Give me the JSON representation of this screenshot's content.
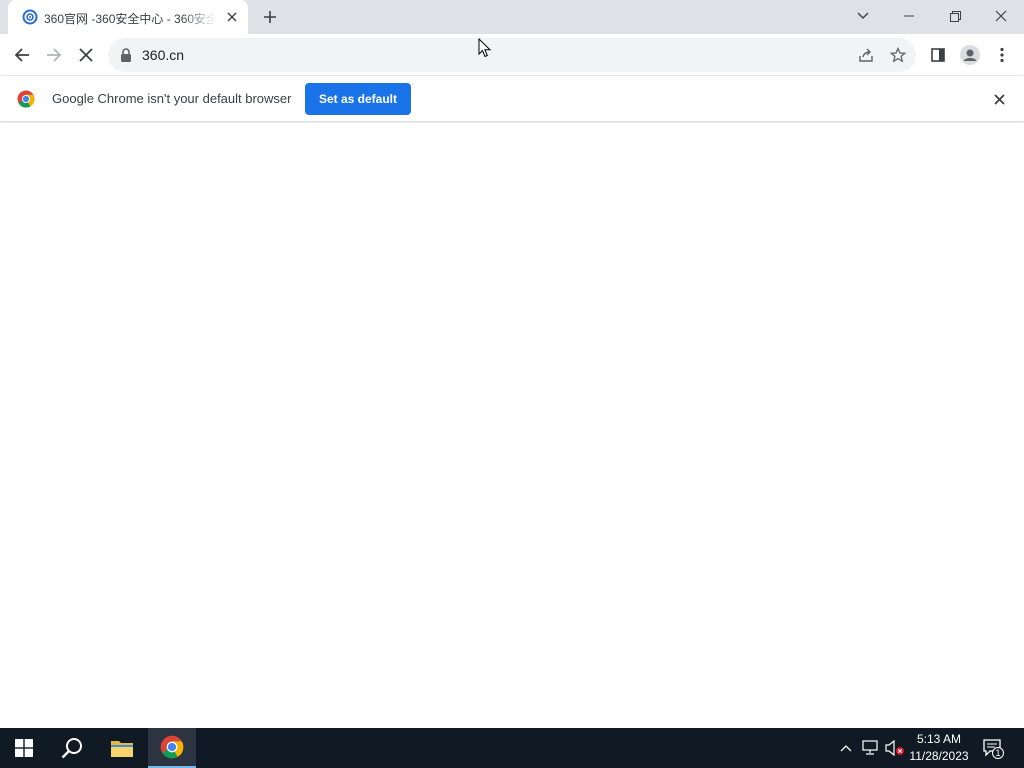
{
  "browser": {
    "tab": {
      "title": "360官网 -360安全中心 - 360安全",
      "favicon": "360-favicon-icon"
    },
    "new_tab_label": "+",
    "window_controls": [
      "tab-search-icon",
      "minimize-icon",
      "restore-icon",
      "close-icon"
    ]
  },
  "toolbar": {
    "url": "360.cn",
    "icons": [
      "back-icon",
      "forward-icon",
      "stop-icon",
      "lock-icon",
      "share-icon",
      "star-icon",
      "side-panel-icon",
      "profile-icon",
      "menu-icon"
    ]
  },
  "infobar": {
    "message": "Google Chrome isn't your default browser",
    "button_label": "Set as default",
    "button_color": "#1a73e8"
  },
  "taskbar": {
    "time": "5:13 AM",
    "date": "11/28/2023",
    "notification_count": "1",
    "background": "#101a24"
  }
}
